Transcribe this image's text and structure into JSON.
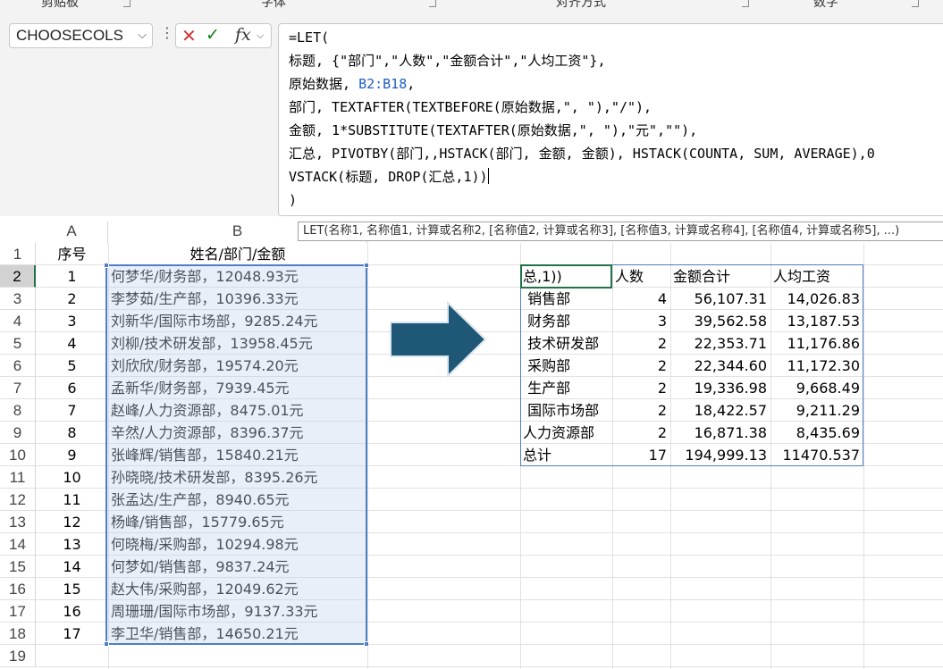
{
  "ribbon": {
    "groups": [
      "剪贴板",
      "字体",
      "对齐方式",
      "数字"
    ]
  },
  "name_box": {
    "value": "CHOOSECOLS"
  },
  "formula_bar": {
    "lines": [
      [
        {
          "t": "=LET("
        }
      ],
      [
        {
          "t": "标题, {\"部门\",\"人数\",\"金额合计\",\"人均工资\"},"
        }
      ],
      [
        {
          "t": "原始数据, "
        },
        {
          "t": "B2:B18",
          "c": "ref"
        },
        {
          "t": ","
        }
      ],
      [
        {
          "t": "部门, TEXTAFTER(TEXTBEFORE(原始数据,\", \"),\"/\"),"
        }
      ],
      [
        {
          "t": "金额, 1*SUBSTITUTE(TEXTAFTER(原始数据,\", \"),\"元\",\"\"),"
        }
      ],
      [
        {
          "t": "汇总, PIVOTBY(部门,,HSTACK(部门, 金额, 金额), HSTACK(COUNTA, SUM, AVERAGE),0"
        }
      ],
      [
        {
          "t": "VSTACK(标题, DROP(汇总,1))"
        },
        {
          "t": "",
          "c": "cursor"
        }
      ],
      [
        {
          "t": ")"
        }
      ]
    ]
  },
  "tooltip": "LET(名称1, 名称值1, 计算或名称2, [名称值2, 计算或名称3], [名称值3, 计算或名称4], [名称值4, 计算或名称5], ...)",
  "sheet": {
    "columns": [
      "A",
      "B"
    ],
    "rows": [
      "1",
      "2",
      "3",
      "4",
      "5",
      "6",
      "7",
      "8",
      "9",
      "10",
      "11",
      "12",
      "13",
      "14",
      "15",
      "16",
      "17",
      "18",
      "19"
    ],
    "header": {
      "a": "序号",
      "b": "姓名/部门/金额"
    },
    "data": [
      [
        "1",
        "何梦华/财务部，12048.93元"
      ],
      [
        "2",
        "李梦茹/生产部，10396.33元"
      ],
      [
        "3",
        "刘新华/国际市场部，9285.24元"
      ],
      [
        "4",
        "刘柳/技术研发部，13958.45元"
      ],
      [
        "5",
        "刘欣欣/财务部，19574.20元"
      ],
      [
        "6",
        "孟新华/财务部，7939.45元"
      ],
      [
        "7",
        "赵峰/人力资源部，8475.01元"
      ],
      [
        "8",
        "辛然/人力资源部，8396.37元"
      ],
      [
        "9",
        "张峰辉/销售部，15840.21元"
      ],
      [
        "10",
        "孙晓晓/技术研发部，8395.26元"
      ],
      [
        "11",
        "张孟达/生产部，8940.65元"
      ],
      [
        "12",
        "杨峰/销售部，15779.65元"
      ],
      [
        "13",
        "何晓梅/采购部，10294.98元"
      ],
      [
        "14",
        "何梦如/销售部，9837.24元"
      ],
      [
        "15",
        "赵大伟/采购部，12049.62元"
      ],
      [
        "16",
        "周珊珊/国际市场部，9137.33元"
      ],
      [
        "17",
        "李卫华/销售部，14650.21元"
      ]
    ]
  },
  "result": {
    "header": [
      "总,1))",
      "人数",
      "金额合计",
      "人均工资"
    ],
    "rows": [
      [
        " 销售部",
        "4",
        "56,107.31",
        "14,026.83"
      ],
      [
        " 财务部",
        "3",
        "39,562.58",
        "13,187.53"
      ],
      [
        " 技术研发部",
        "2",
        "22,353.71",
        "11,176.86"
      ],
      [
        " 采购部",
        "2",
        "22,344.60",
        "11,172.30"
      ],
      [
        " 生产部",
        "2",
        "19,336.98",
        "9,668.49"
      ],
      [
        " 国际市场部",
        "2",
        "18,422.57",
        "9,211.29"
      ],
      [
        "人力资源部",
        "2",
        "16,871.38",
        "8,435.69"
      ],
      [
        "总计",
        "17",
        "194,999.13",
        "11470.537"
      ]
    ]
  },
  "colors": {
    "arrow": "#1f5777",
    "selection_border": "#4f7fc3",
    "active_cell": "#217346",
    "ref_text": "#1e5ec6"
  }
}
